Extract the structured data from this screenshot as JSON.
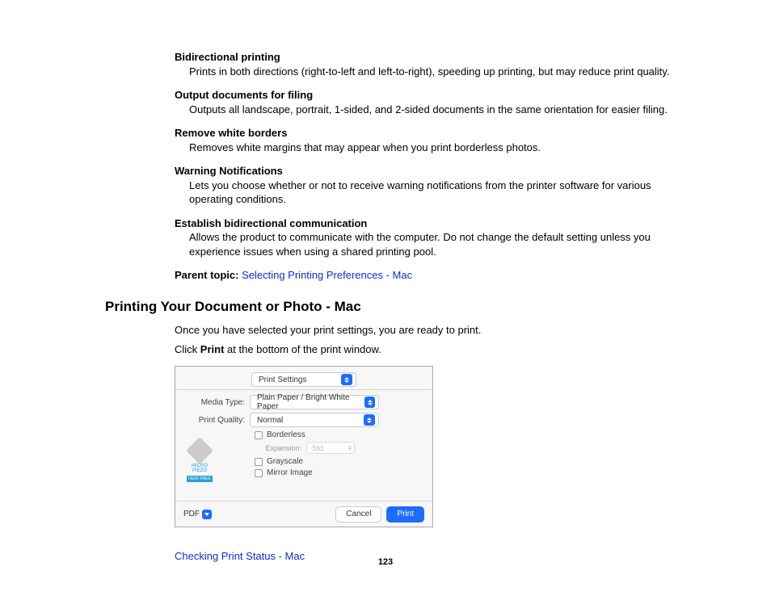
{
  "defs": [
    {
      "term": "Bidirectional printing",
      "body": "Prints in both directions (right-to-left and left-to-right), speeding up printing, but may reduce print quality."
    },
    {
      "term": "Output documents for filing",
      "body": "Outputs all landscape, portrait, 1-sided, and 2-sided documents in the same orientation for easier filing."
    },
    {
      "term": "Remove white borders",
      "body": "Removes white margins that may appear when you print borderless photos."
    },
    {
      "term": "Warning Notifications",
      "body": "Lets you choose whether or not to receive warning notifications from the printer software for various operating conditions."
    },
    {
      "term": "Establish bidirectional communication",
      "body": "Allows the product to communicate with the computer. Do not change the default setting unless you experience issues when using a shared printing pool."
    }
  ],
  "parent": {
    "label": "Parent topic:",
    "link": "Selecting Printing Preferences - Mac"
  },
  "section_title": "Printing Your Document or Photo - Mac",
  "intro1": "Once you have selected your print settings, you are ready to print.",
  "intro2_pre": "Click ",
  "intro2_bold": "Print",
  "intro2_post": " at the bottom of the print window.",
  "dialog": {
    "dropdown_main": "Print Settings",
    "media_label": "Media Type:",
    "media_value": "Plain Paper / Bright White Paper",
    "quality_label": "Print Quality:",
    "quality_value": "Normal",
    "chk_borderless": "Borderless",
    "exp_label": "Expansion:",
    "exp_value": "Std.",
    "chk_grayscale": "Grayscale",
    "chk_mirror": "Mirror Image",
    "icon_line1": "MICRO PIEZO",
    "icon_line2": "HEAT-FREE",
    "pdf": "PDF",
    "cancel": "Cancel",
    "print": "Print"
  },
  "related_link": "Checking Print Status - Mac",
  "pagenum": "123"
}
